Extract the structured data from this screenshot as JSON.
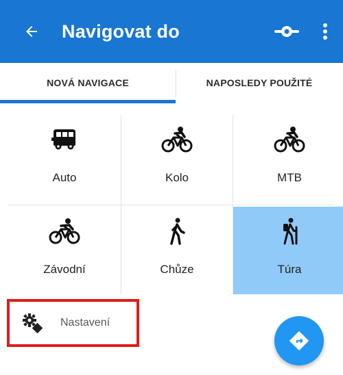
{
  "appbar": {
    "title": "Navigovat do",
    "back_icon": "arrow-left-icon",
    "route_icon": "route-points-icon",
    "menu_icon": "more-vert-icon",
    "color": "#1976d2"
  },
  "tabs": [
    {
      "label": "NOVÁ NAVIGACE",
      "selected": true
    },
    {
      "label": "NAPOSLEDY POUŽITÉ",
      "selected": false
    }
  ],
  "modes": [
    {
      "label": "Auto",
      "icon": "car-icon",
      "selected": false
    },
    {
      "label": "Kolo",
      "icon": "bike-icon",
      "selected": false
    },
    {
      "label": "MTB",
      "icon": "mtb-icon",
      "selected": false
    },
    {
      "label": "Závodní",
      "icon": "road-bike-icon",
      "selected": false
    },
    {
      "label": "Chůze",
      "icon": "walk-icon",
      "selected": false
    },
    {
      "label": "Túra",
      "icon": "hike-icon",
      "selected": true
    }
  ],
  "settings": {
    "label": "Nastavení",
    "icon": "settings-route-icon"
  },
  "fab": {
    "icon": "directions-icon",
    "color": "#2196f3"
  },
  "selected_color": "#90caf9"
}
